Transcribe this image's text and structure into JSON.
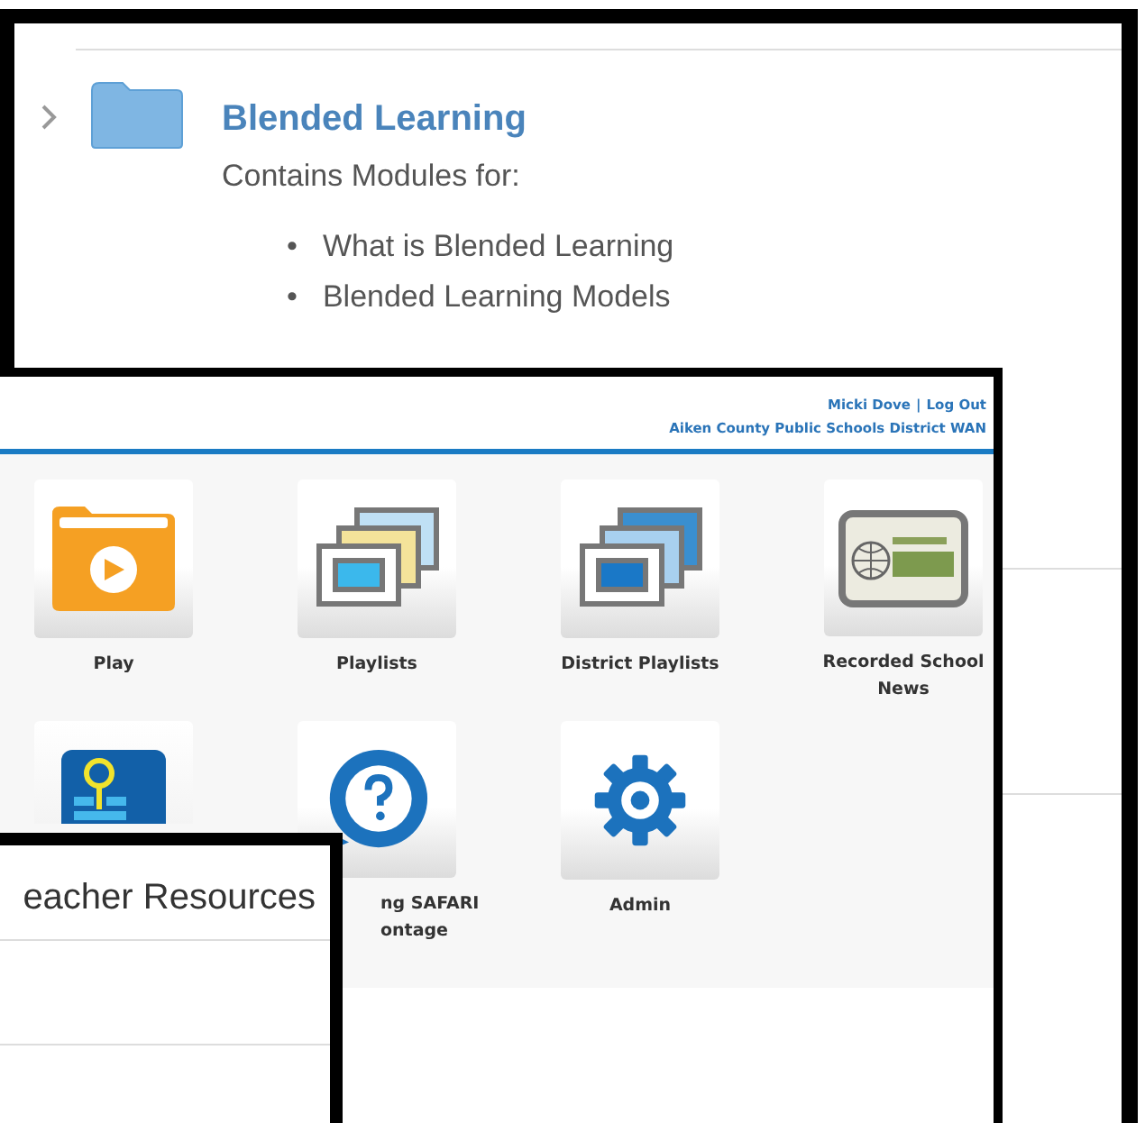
{
  "background_page": {
    "folder": {
      "title": "Blended Learning",
      "expanded": false,
      "description": "Contains Modules for:",
      "modules": [
        {
          "bullet": "•",
          "text": "What is Blended Learning"
        },
        {
          "bullet": "•",
          "text": "Blended Learning Models"
        }
      ]
    }
  },
  "portal": {
    "user": "Micki Dove",
    "separator": "|",
    "logout": "Log Out",
    "organization": "Aiken County Public Schools District WAN",
    "tiles": [
      {
        "kind": "play",
        "label": "Play"
      },
      {
        "kind": "playlists",
        "label": "Playlists"
      },
      {
        "kind": "district-playlists",
        "label": "District Playlists"
      },
      {
        "kind": "news",
        "label": "Recorded School News"
      },
      {
        "kind": "hub"
      },
      {
        "kind": "help",
        "label": "ng SAFARI ontage"
      },
      {
        "kind": "admin",
        "label": "Admin"
      }
    ]
  },
  "front_page": {
    "heading": "eacher Resources"
  }
}
